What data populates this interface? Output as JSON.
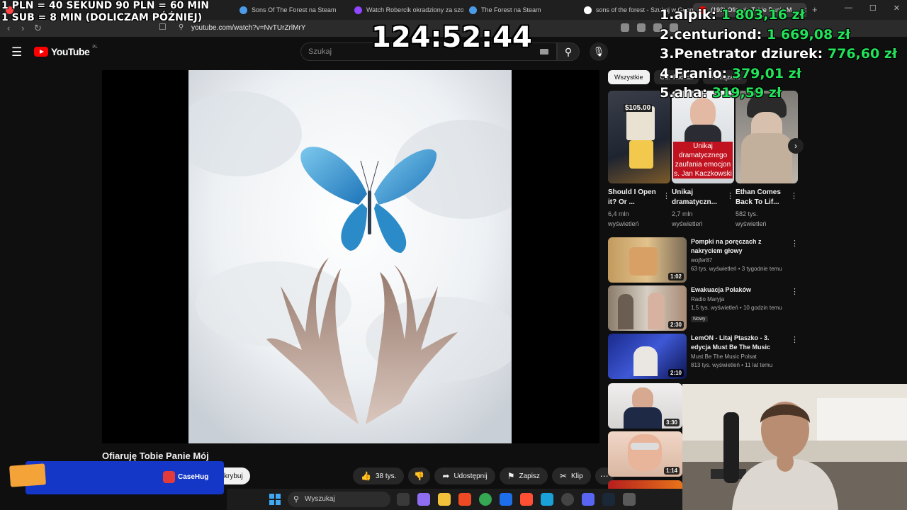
{
  "browser": {
    "tabs": [
      {
        "label": "",
        "favicon_color": "#ff4444"
      },
      {
        "label": "Sons Of The Forest na Steam",
        "favicon_color": "#4c9be8"
      },
      {
        "label": "Watch Robercik okradziony za szota",
        "favicon_color": "#9146ff"
      },
      {
        "label": "The Forest na Steam",
        "favicon_color": "#4c9be8"
      },
      {
        "label": "sons of the forest - Szukaj w Google",
        "favicon_color": "#ffffff"
      },
      {
        "label": "(193) Ofiaruję Tobie Panie M...",
        "favicon_color": "#ff0000"
      }
    ],
    "url": "youtube.com/watch?v=NvTUrZrlMrY"
  },
  "youtube": {
    "logo_text": "YouTube",
    "country_code": "PL",
    "search_placeholder": "Szukaj",
    "video_title": "Ofiaruję Tobie Panie Mój",
    "subscribe_label": "krybuj",
    "actions": {
      "likes": "38 tys.",
      "share": "Udostępnij",
      "save": "Zapisz",
      "clip": "Klip"
    },
    "chips": [
      "Wszystkie",
      "Od: Twórca",
      "Powiązane"
    ],
    "shorts": [
      {
        "title": "Should I Open it? Or ...",
        "views": "6,4 mln wyświetleń",
        "overlay": "$105.00"
      },
      {
        "title": "Unikaj dramatyczn...",
        "views": "2,7 mln wyświetleń",
        "overlay": "Unikaj dramatycznego zaufania emocjon s. Jan Kaczkowski"
      },
      {
        "title": "Ethan Comes Back To Lif...",
        "views": "582 tys. wyświetleń",
        "overlay": ""
      }
    ],
    "related": [
      {
        "title": "Pompki na poręczach z nakryciem głowy",
        "channel": "wojfer87",
        "meta": "63 tys. wyświetleń • 3 tygodnie temu",
        "duration": "1:02",
        "badge": ""
      },
      {
        "title": "Ewakuacja Polaków",
        "channel": "Radio Maryja",
        "meta": "1,5 tys. wyświetleń • 10 godzin temu",
        "duration": "2:30",
        "badge": "Nowy"
      },
      {
        "title": "LemON - Litaj Ptaszko - 3. edycja Must Be The Music",
        "channel": "Must Be The Music Polsat",
        "meta": "813 tys. wyświetleń • 11 lat temu",
        "duration": "2:10",
        "badge": ""
      },
      {
        "title": "",
        "channel": "",
        "meta": "",
        "duration": "3:30",
        "badge": ""
      },
      {
        "title": "",
        "channel": "",
        "meta": "",
        "duration": "1:14",
        "badge": ""
      }
    ]
  },
  "stream_overlay": {
    "rates_line1": "1 PLN =  40 SEKUND 90 PLN = 60 MIN",
    "rates_line2": "1 SUB = 8 MIN (DOLICZAM PÓŹNIEJ)",
    "timer": "124:52:44",
    "leaderboard": [
      {
        "rank": "1.",
        "name": "alpik:",
        "amount": "1 803,16 zł"
      },
      {
        "rank": "2.",
        "name": "centuriond:",
        "amount": "1 669,08 zł"
      },
      {
        "rank": "3.",
        "name": "Penetrator dziurek:",
        "amount": "776,60 zł"
      },
      {
        "rank": "4.",
        "name": "Franio:",
        "amount": "379,01 zł"
      },
      {
        "rank": "5.",
        "name": "aha:",
        "amount": "319,59 zł"
      }
    ],
    "sponsor": "CaseHug"
  },
  "taskbar": {
    "search_label": "Wyszukaj"
  }
}
